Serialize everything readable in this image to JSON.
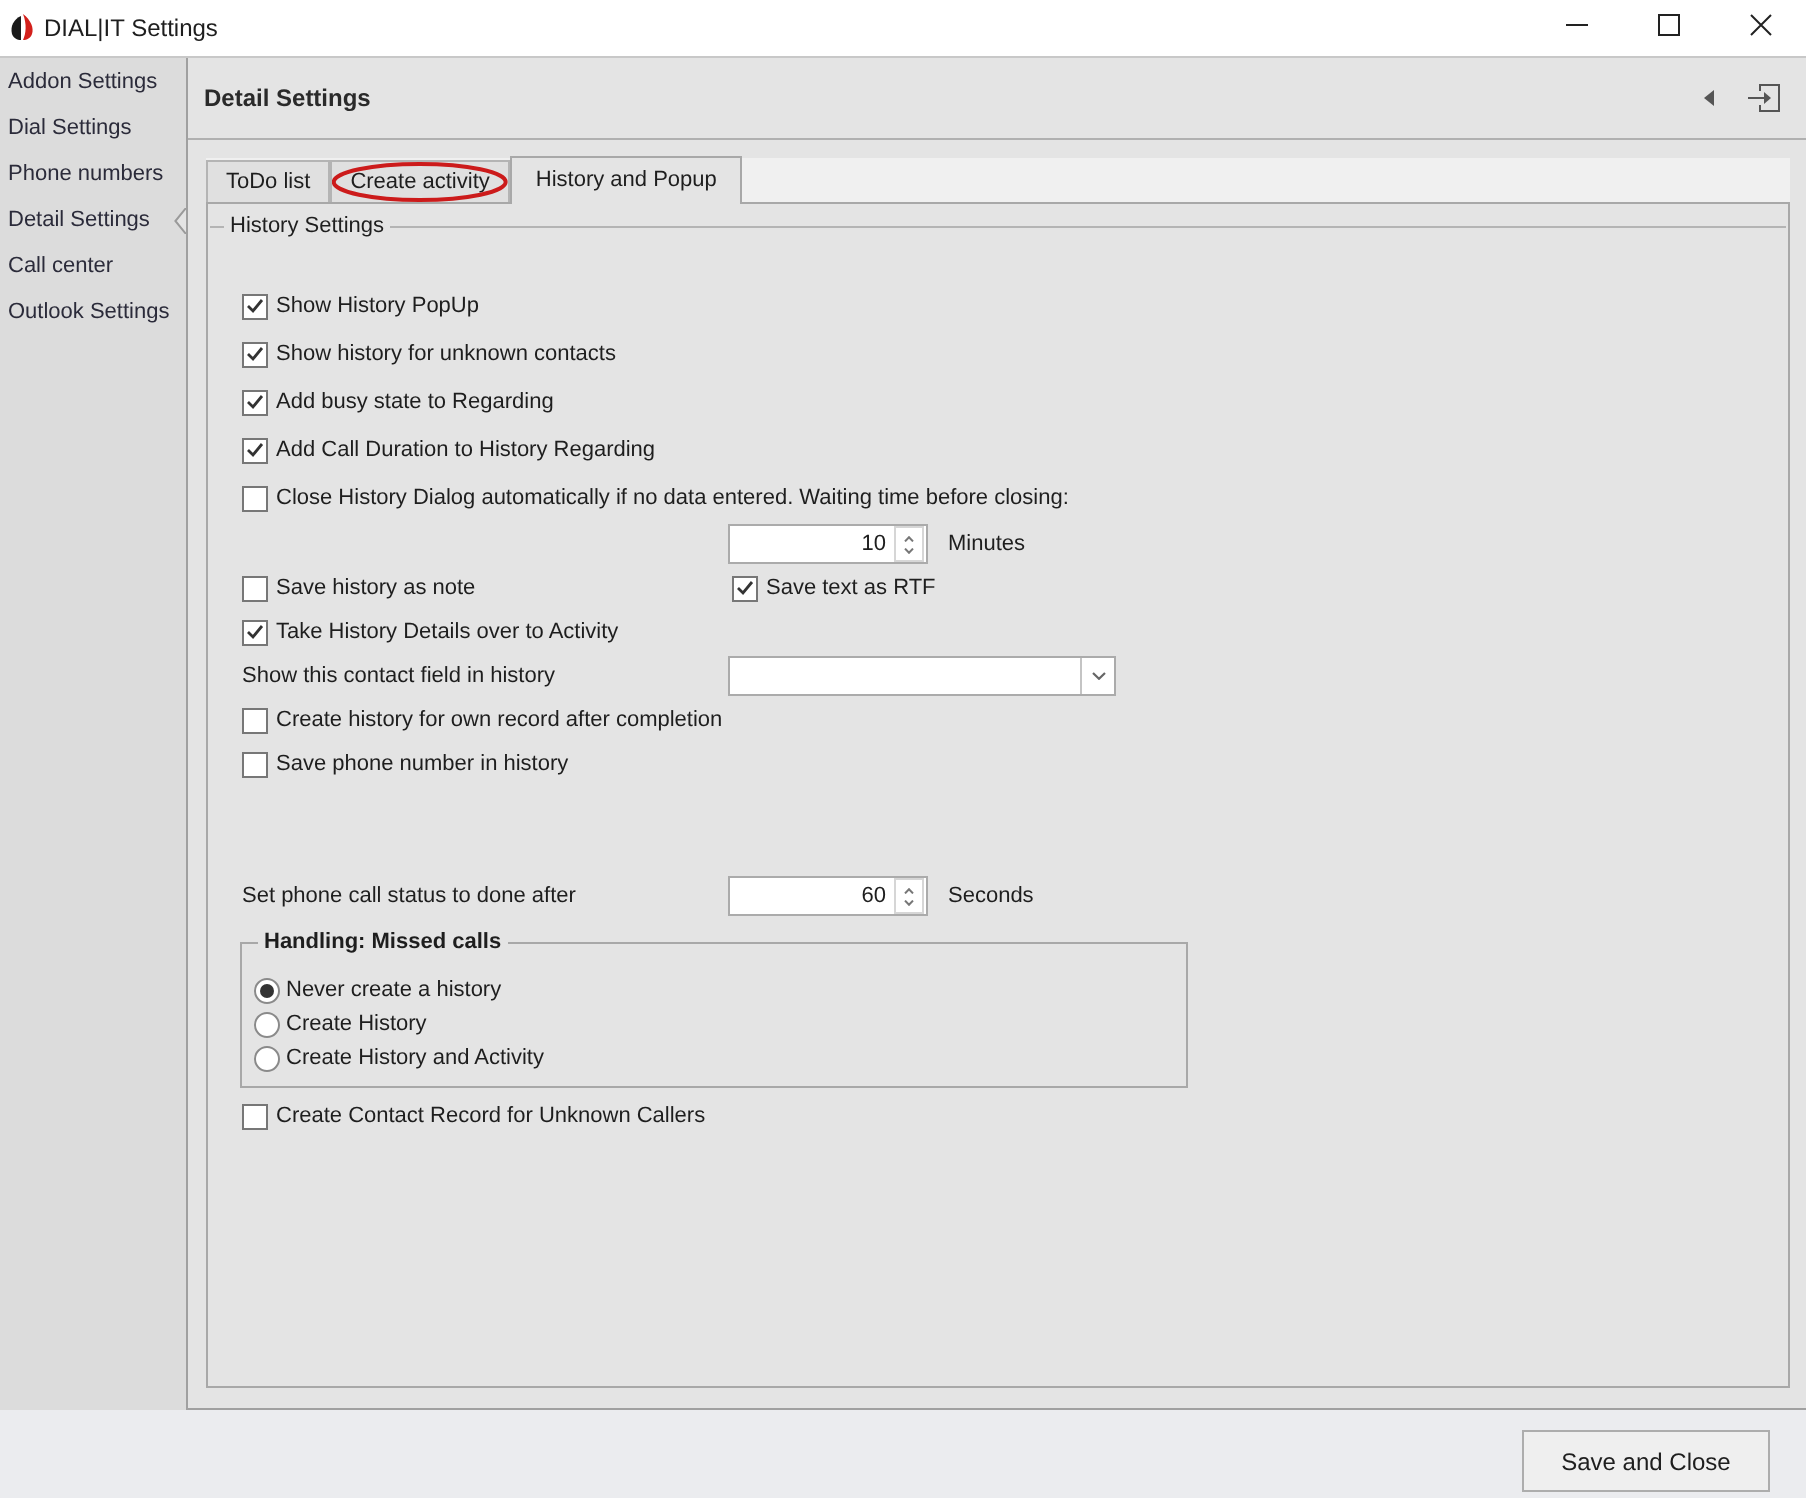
{
  "window": {
    "title": "DIAL|IT Settings"
  },
  "sidebar": {
    "items": [
      {
        "label": "Addon Settings",
        "selected": false
      },
      {
        "label": "Dial Settings",
        "selected": false
      },
      {
        "label": "Phone numbers",
        "selected": false
      },
      {
        "label": "Detail Settings",
        "selected": true
      },
      {
        "label": "Call center",
        "selected": false
      },
      {
        "label": "Outlook Settings",
        "selected": false
      }
    ]
  },
  "panel": {
    "title": "Detail Settings"
  },
  "tabs": [
    {
      "label": "ToDo list",
      "selected": false,
      "circled": false
    },
    {
      "label": "Create activity",
      "selected": false,
      "circled": true
    },
    {
      "label": "History and Popup",
      "selected": true,
      "circled": false
    }
  ],
  "history_settings": {
    "title": "History Settings",
    "options": [
      {
        "kind": "checkbox",
        "label": "Show History PopUp",
        "checked": true
      },
      {
        "kind": "checkbox",
        "label": "Show history for unknown contacts",
        "checked": true
      },
      {
        "kind": "checkbox",
        "label": "Add busy state to Regarding",
        "checked": true
      },
      {
        "kind": "checkbox",
        "label": "Add Call Duration to History Regarding",
        "checked": true
      },
      {
        "kind": "checkbox",
        "label": "Close History Dialog automatically if no data entered. Waiting time before closing:",
        "checked": false
      },
      {
        "kind": "spinner",
        "value": "10",
        "unit": "Minutes"
      },
      {
        "kind": "checkbox_pair",
        "items": [
          {
            "label": "Save history as note",
            "checked": false
          },
          {
            "label": "Save text as RTF",
            "checked": true
          }
        ]
      },
      {
        "kind": "checkbox",
        "label": "Take History Details over to Activity",
        "checked": true
      },
      {
        "kind": "dropdown",
        "label": "Show this contact field in history"
      },
      {
        "kind": "checkbox",
        "label": "Create history for own record after completion",
        "checked": false
      },
      {
        "kind": "checkbox",
        "label": "Save phone number in history",
        "checked": false
      }
    ],
    "call_status": {
      "label": "Set phone call status to done after",
      "value": "60",
      "unit": "Seconds"
    },
    "missed_calls": {
      "title": "Handling: Missed calls",
      "options": [
        {
          "label": "Never create a history",
          "selected": true
        },
        {
          "label": "Create History",
          "selected": false
        },
        {
          "label": "Create History and Activity",
          "selected": false
        }
      ]
    },
    "create_contact_record": {
      "label": "Create Contact Record for Unknown Callers",
      "checked": false
    }
  },
  "footer": {
    "buttons": [
      "Save and Close"
    ]
  }
}
